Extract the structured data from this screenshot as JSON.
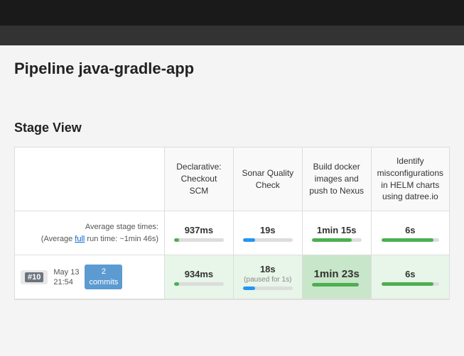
{
  "topbar": {},
  "pipeline": {
    "title": "Pipeline java-gradle-app"
  },
  "stageView": {
    "label": "Stage View",
    "stages": [
      {
        "id": "declarative-checkout-scm",
        "header": "Declarative:\nCheckout SCM"
      },
      {
        "id": "sonar-quality-check",
        "header": "Sonar Quality\nCheck"
      },
      {
        "id": "build-docker-images",
        "header": "Build docker images and push to Nexus"
      },
      {
        "id": "identify-misconfigurations",
        "header": "Identify misconfigurations in HELM charts using datree.io"
      }
    ],
    "avgRow": {
      "label": "Average stage times:",
      "subLabel": "(Average",
      "fullLink": "full",
      "subLabel2": "run time: ~1min 46s)",
      "stageTimes": [
        "937ms",
        "19s",
        "1min 15s",
        "6s"
      ],
      "progressWidths": [
        "10",
        "25",
        "80",
        "90"
      ]
    },
    "build": {
      "number": "#10",
      "date": "May 13",
      "time": "21:54",
      "commits": "2",
      "commitsLabel": "commits",
      "stageTimes": [
        "934ms",
        "18s",
        "1min 23s",
        "6s"
      ],
      "stagePaused": [
        false,
        true,
        false,
        false
      ],
      "pausedLabel": "(paused for 1s)",
      "progressWidths": [
        "10",
        "25",
        "95",
        "90"
      ]
    }
  }
}
